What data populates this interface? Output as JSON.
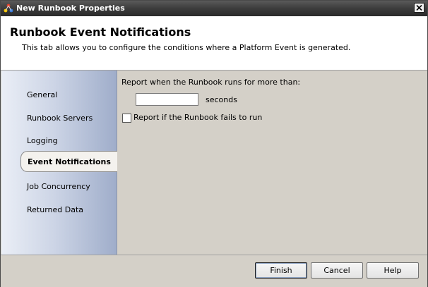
{
  "window": {
    "title": "New Runbook Properties"
  },
  "header": {
    "title": "Runbook Event Notifications",
    "description": "This tab allows you to configure the conditions where a Platform Event is generated."
  },
  "sidebar": {
    "items": [
      {
        "label": "General"
      },
      {
        "label": "Runbook Servers"
      },
      {
        "label": "Logging"
      },
      {
        "label": "Event Notifications",
        "selected": true
      },
      {
        "label": "Job Concurrency"
      },
      {
        "label": "Returned Data"
      }
    ]
  },
  "content": {
    "report_label": "Report when the Runbook runs for more than:",
    "seconds_value": "",
    "seconds_label": "seconds",
    "fail_checkbox_label": "Report if the Runbook fails to run",
    "fail_checked": false
  },
  "footer": {
    "finish_label": "Finish",
    "cancel_label": "Cancel",
    "help_label": "Help"
  },
  "icons": {
    "app": "runbook-app-icon",
    "close": "close-icon"
  }
}
